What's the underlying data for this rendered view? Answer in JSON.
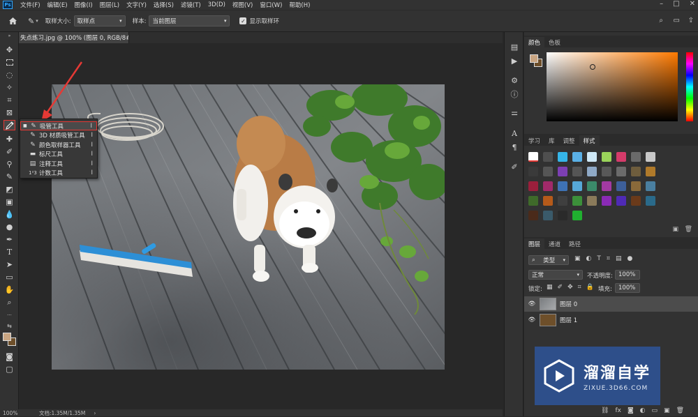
{
  "menubar": {
    "logo": "Ps",
    "items": [
      "文件(F)",
      "编辑(E)",
      "图像(I)",
      "图层(L)",
      "文字(Y)",
      "选择(S)",
      "滤镜(T)",
      "3D(D)",
      "视图(V)",
      "窗口(W)",
      "帮助(H)"
    ]
  },
  "options": {
    "sample_size_label": "取样大小:",
    "sample_size_value": "取样点",
    "sample_label": "样本:",
    "sample_value": "当前图层",
    "show_ring_label": "显示取样环"
  },
  "document": {
    "tab_title": "失点练习.jpg @ 100% (图层 0, RGB/8#) *"
  },
  "status": {
    "zoom": "100%",
    "doc_size": "文档:1.35M/1.35M"
  },
  "flyout": {
    "items": [
      {
        "icon": "eyedropper-icon",
        "label": "吸管工具",
        "key": "I"
      },
      {
        "icon": "3d-material-eyedropper-icon",
        "label": "3D 材质吸管工具",
        "key": "I"
      },
      {
        "icon": "color-sampler-icon",
        "label": "颜色取样器工具",
        "key": "I"
      },
      {
        "icon": "ruler-icon",
        "label": "标尺工具",
        "key": "I"
      },
      {
        "icon": "note-icon",
        "label": "注释工具",
        "key": "I"
      },
      {
        "icon": "count-icon",
        "label": "计数工具",
        "key": "I"
      }
    ]
  },
  "color_panel": {
    "tabs": [
      "颜色",
      "色板"
    ],
    "foreground": "#c9a582",
    "background": "#6e4f2a"
  },
  "styles_panel": {
    "tabs": [
      "学习",
      "库",
      "调整",
      "样式"
    ]
  },
  "layers_panel": {
    "tabs": [
      "图层",
      "通道",
      "路径"
    ],
    "filter_label": "类型",
    "blend_mode": "正常",
    "opacity_label": "不透明度:",
    "opacity_value": "100%",
    "lock_label": "锁定:",
    "fill_label": "填充:",
    "fill_value": "100%",
    "layers": [
      {
        "name": "图层 0",
        "selected": true
      },
      {
        "name": "图层 1",
        "selected": false
      }
    ]
  },
  "watermark": {
    "title": "溜溜自学",
    "url": "ZIXUE.3D66.COM"
  },
  "colors": {
    "accent_red": "#e53935",
    "selection_blue": "#3e6da8"
  }
}
